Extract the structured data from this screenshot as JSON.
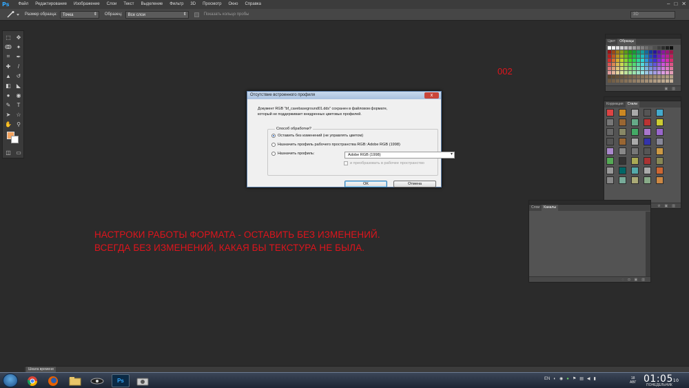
{
  "app": {
    "logo": "Ps"
  },
  "menu": [
    "Файл",
    "Редактирование",
    "Изображение",
    "Слои",
    "Текст",
    "Выделение",
    "Фильтр",
    "3D",
    "Просмотр",
    "Окно",
    "Справка"
  ],
  "window_controls": {
    "minimize": "–",
    "maximize": "□",
    "close": "✕"
  },
  "options": {
    "sample_size_label": "Размер образца:",
    "sample_size_value": "Точка",
    "sample_label": "Образец:",
    "sample_value": "Все слои",
    "show_ring_label": "Показать кольцо пробы",
    "workspace_value": "3D"
  },
  "annotations": {
    "number": "002",
    "line1": "НАСТРОКИ  РАБОТЫ ФОРМАТА - ОСТАВИТЬ БЕЗ ИЗМЕНЕНИЙ.",
    "line2": "ВСЕГДА БЕЗ ИЗМЕНЕНИЙ, КАКАЯ БЫ ТЕКСТУРА НЕ БЫЛА."
  },
  "dialog": {
    "title": "Отсутствие встроенного профиля",
    "close_label": "x",
    "message_line1": "Документ RGB \"bf_cavebaseground01.dds\" сохранен в файловом формате,",
    "message_line2": "который не поддерживает внедренных цветовых профилей.",
    "group_title": "Способ обработки?",
    "option1": "Оставить без изменений (не управлять цветом)",
    "option2": "Назначить профиль рабочего пространства RGB:  Adobe RGB (1998)",
    "option3": "Назначить профиль:",
    "profile_value": "Adobe RGB (1998)",
    "convert_label": "и преобразовать в рабочее пространство",
    "ok": "OK",
    "cancel": "Отмена"
  },
  "panels": {
    "swatches": {
      "tab1": "Цвет",
      "tab2": "Образцы"
    },
    "styles": {
      "tab1": "Коррекция",
      "tab2": "Стили"
    },
    "layers": {
      "tab1": "Слои",
      "tab2": "Каналы"
    }
  },
  "timeline": {
    "label": "Шкала времени"
  },
  "taskbar": {
    "lang": "EN",
    "date_day": "18",
    "date_month": "АВГ",
    "time": "01:05",
    "seconds": "10",
    "weekday": "ПОНЕДЕЛЬНИК"
  },
  "colors": {
    "annotation": "#e0141c",
    "foreground": "#f4a460",
    "background": "#ffffff",
    "workspace": "#2b2b2b"
  }
}
